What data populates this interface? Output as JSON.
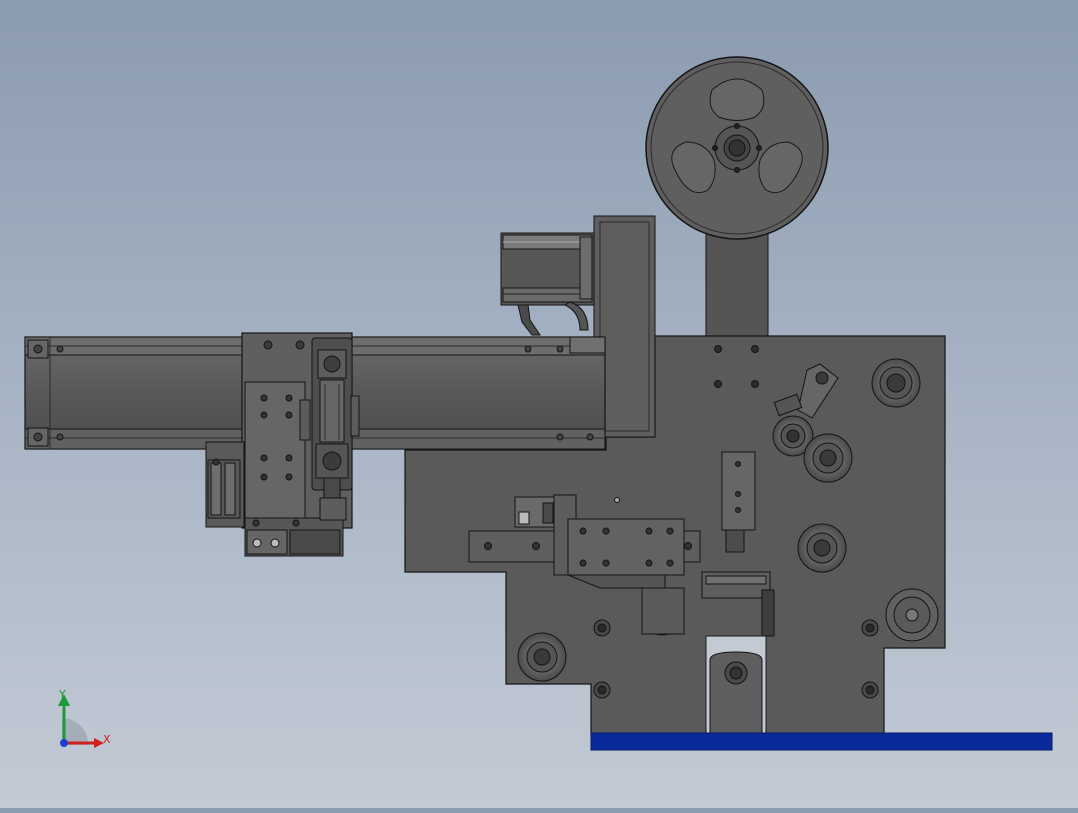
{
  "colors": {
    "part_fill": "#5c5c5c",
    "part_fill_light": "#6a6a6a",
    "part_fill_dark": "#474747",
    "edge": "#141414",
    "base_plate": "#0a2a9c",
    "axis_x": "#d02020",
    "axis_y": "#1a9a3a",
    "axis_z": "#1f3fd0"
  },
  "icons": [
    "coordinate-triad-icon"
  ],
  "triad": {
    "x_label": "X",
    "y_label": "Y"
  }
}
